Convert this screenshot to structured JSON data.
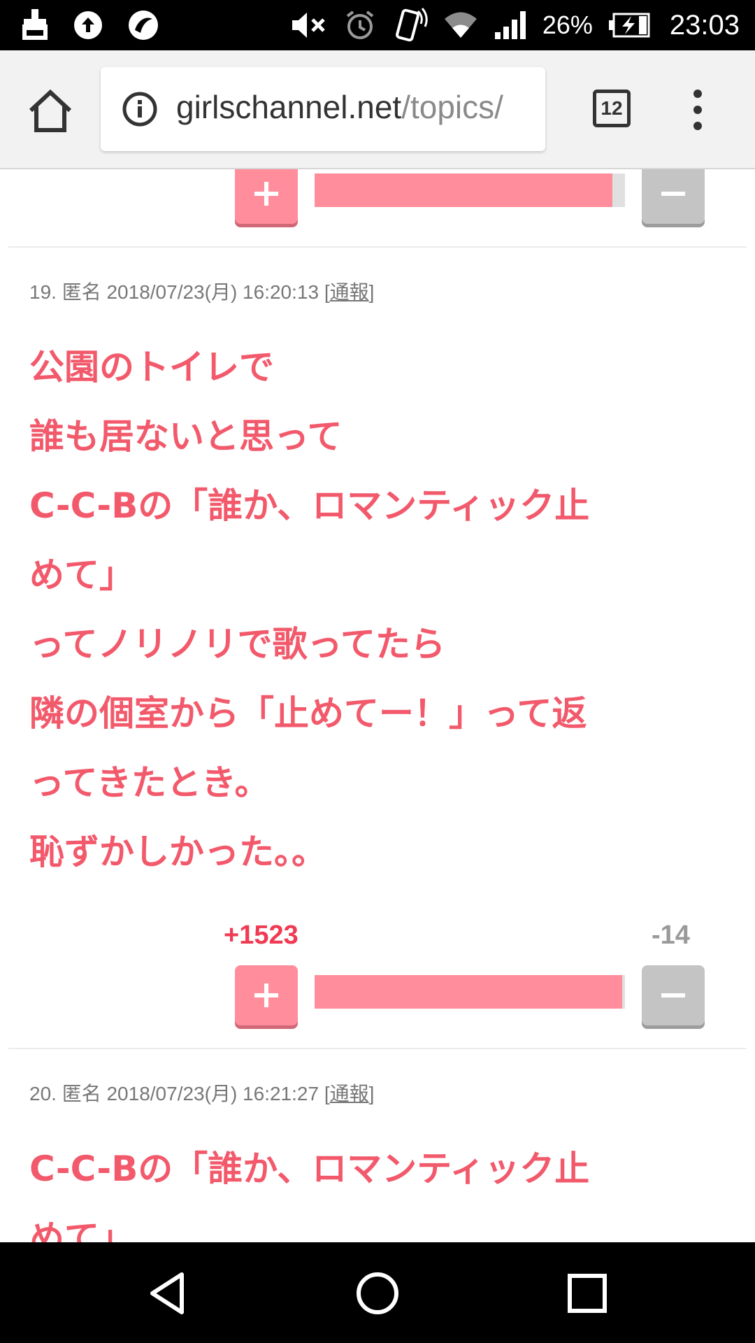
{
  "status_bar": {
    "left_icons": [
      "cleaner-app-icon",
      "upload-icon",
      "app-notification-icon"
    ],
    "right_icons": [
      "mute-icon",
      "alarm-icon",
      "vibrate-icon",
      "wifi-icon",
      "signal-icon",
      "battery-charging-icon"
    ],
    "battery_percent": "26%",
    "time": "23:03"
  },
  "browser": {
    "url_domain": "girlschannel.net",
    "url_path": "/topics/",
    "tab_count": "12",
    "icons": [
      "home-icon",
      "info-icon",
      "tabs-icon",
      "overflow-menu-icon"
    ]
  },
  "comments": [
    {
      "vote": {
        "plus_fraction": 0.96
      }
    },
    {
      "meta": {
        "prefix": "19. 匿名 2018/07/23(月) 16:20:13 [",
        "report": "通報",
        "suffix": "]"
      },
      "lines": [
        "公園のトイレで",
        "誰も居ないと思って",
        "C-C-Bの「誰か、ロマンティック止",
        "めて」",
        "ってノリノリで歌ってたら",
        "隣の個室から「止めてー！」って返",
        "ってきたとき。",
        "恥ずかしかった。。"
      ],
      "vote": {
        "plus_count": "+1523",
        "minus_count": "-14",
        "plus_fraction": 0.99
      }
    },
    {
      "meta": {
        "prefix": "20. 匿名 2018/07/23(月) 16:21:27 [",
        "report": "通報",
        "suffix": "]"
      },
      "lines": [
        "C-C-Bの「誰か、ロマンティック止",
        "めて」"
      ]
    }
  ],
  "colors": {
    "accent_text": "#f25a6c",
    "plus_button": "#ff8d9b",
    "plus_count": "#ef3b53",
    "minus_button": "#c4c4c4"
  },
  "nav_bar": {
    "icons": [
      "back-icon",
      "home-circle-icon",
      "recents-icon"
    ]
  }
}
